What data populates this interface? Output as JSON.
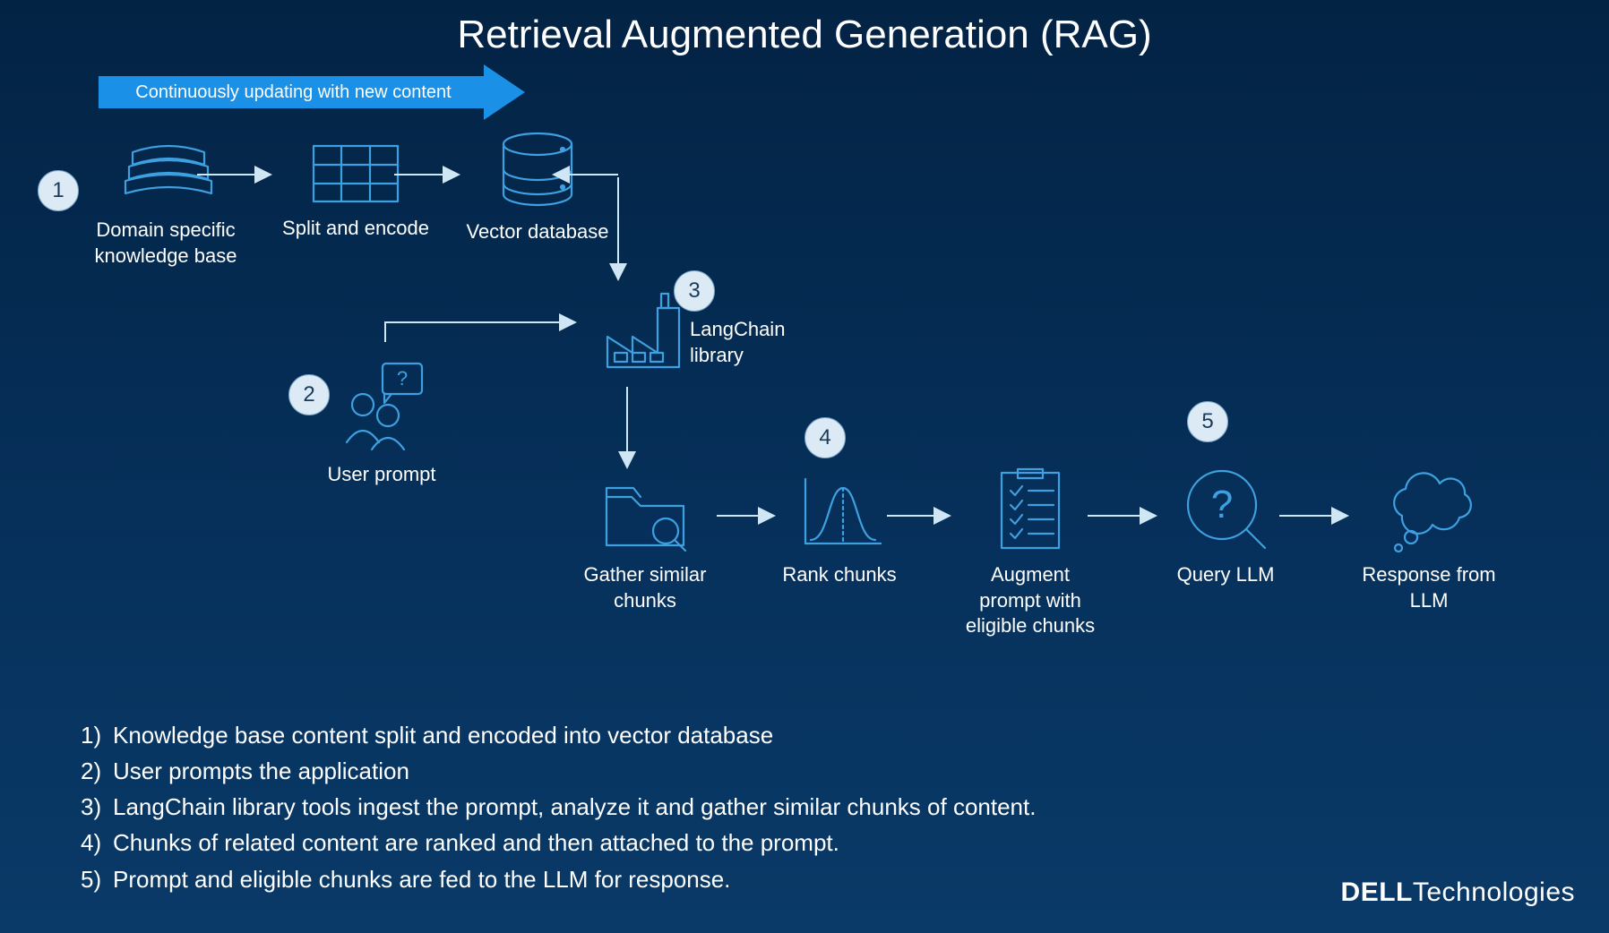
{
  "title": "Retrieval Augmented Generation (RAG)",
  "banner": "Continuously updating with new content",
  "nodes": {
    "kb": {
      "label": "Domain specific\nknowledge base"
    },
    "split": {
      "label": "Split and encode"
    },
    "vector": {
      "label": "Vector database"
    },
    "user": {
      "label": "User prompt"
    },
    "lang": {
      "label": "LangChain\nlibrary"
    },
    "gather": {
      "label": "Gather similar\nchunks"
    },
    "rank": {
      "label": "Rank chunks"
    },
    "augment": {
      "label": "Augment\nprompt with\neligible chunks"
    },
    "query": {
      "label": "Query LLM"
    },
    "resp": {
      "label": "Response from\nLLM"
    }
  },
  "steps": {
    "1": "1",
    "2": "2",
    "3": "3",
    "4": "4",
    "5": "5"
  },
  "legend": [
    "Knowledge base content split and encoded into vector database",
    "User prompts the application",
    "LangChain library tools ingest the prompt, analyze it and gather similar chunks of content.",
    "Chunks of related content are ranked and then attached to the prompt.",
    "Prompt and eligible chunks are fed to the LLM for response."
  ],
  "logo": {
    "brand": "DELL",
    "suffix": "Technologies"
  }
}
